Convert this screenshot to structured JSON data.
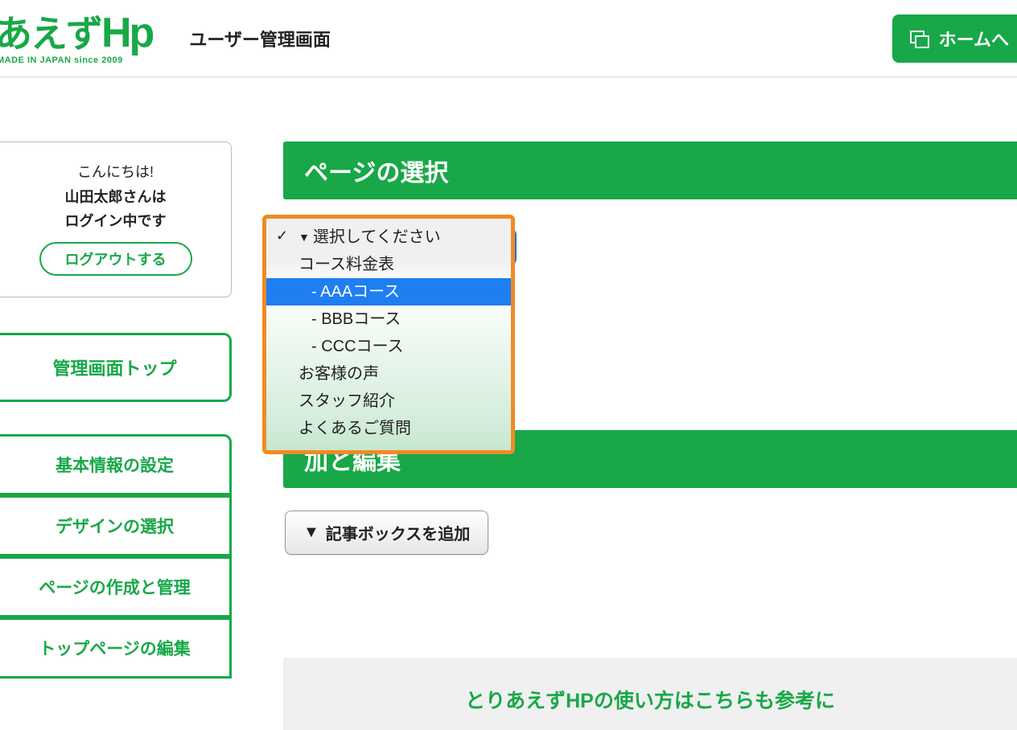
{
  "header": {
    "logo_main": "あえず",
    "logo_hp": "Hp",
    "logo_tag": "MADE IN JAPAN since 2009",
    "title": "ユーザー管理画面",
    "home_btn": "ホームへ"
  },
  "login": {
    "greet": "こんにちは!",
    "user": "山田太郎さんは",
    "status": "ログイン中です",
    "logout": "ログアウトする"
  },
  "nav": {
    "top": "管理画面トップ",
    "items": [
      "基本情報の設定",
      "デザインの選択",
      "ページの作成と管理",
      "トップページの編集"
    ]
  },
  "sections": {
    "page_select": "ページの選択",
    "article_edit": "加と編集"
  },
  "buttons": {
    "add_box_caret": "▼",
    "add_box": "記事ボックスを追加"
  },
  "help": {
    "banner": "とりあえずHPの使い方はこちらも参考に"
  },
  "dropdown": {
    "caret": "▼",
    "placeholder": "選択してください",
    "options": [
      {
        "label": "コース料金表",
        "indent": false
      },
      {
        "label": "- AAAコース",
        "indent": true,
        "selected": true
      },
      {
        "label": "- BBBコース",
        "indent": true
      },
      {
        "label": "- CCCコース",
        "indent": true
      },
      {
        "label": "お客様の声",
        "indent": false
      },
      {
        "label": "スタッフ紹介",
        "indent": false
      },
      {
        "label": "よくあるご質問",
        "indent": false
      }
    ]
  }
}
